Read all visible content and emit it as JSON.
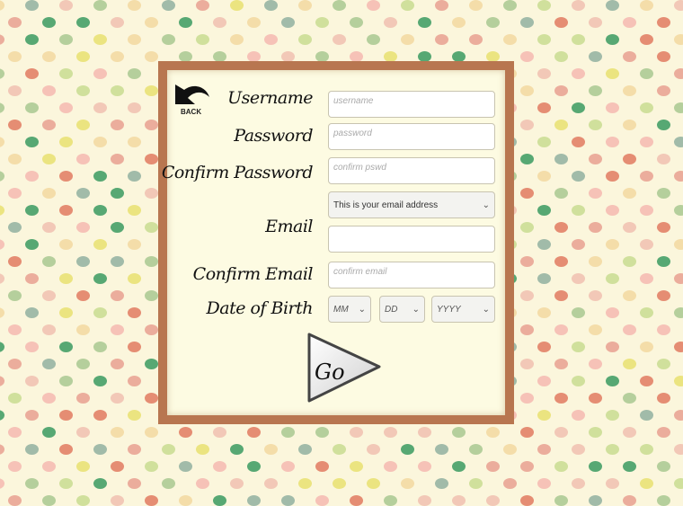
{
  "back_button": {
    "label": "BACK",
    "icon": "curved-arrow-back-icon"
  },
  "form": {
    "username": {
      "label": "Username",
      "placeholder": "username",
      "value": ""
    },
    "password": {
      "label": "Password",
      "placeholder": "password",
      "value": ""
    },
    "confirm_password": {
      "label": "Confirm Password",
      "placeholder": "confirm pswd",
      "value": ""
    },
    "email_hint_select": {
      "selected": "This is your email address"
    },
    "email": {
      "label": "Email",
      "placeholder": "",
      "value": ""
    },
    "confirm_email": {
      "label": "Confirm Email",
      "placeholder": "confirm email",
      "value": ""
    },
    "dob": {
      "label": "Date of Birth",
      "month": "MM",
      "day": "DD",
      "year": "YYYY"
    }
  },
  "go_button": {
    "label": "Go",
    "icon": "play-triangle-icon"
  },
  "colors": {
    "frame": "#b87650",
    "panel": "#fdfbe2",
    "background": "#fbf6dc"
  }
}
